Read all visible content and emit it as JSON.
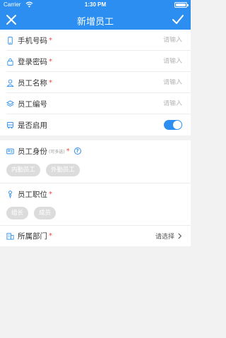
{
  "status_bar": {
    "carrier": "Carrier",
    "time": "1:30 PM"
  },
  "nav": {
    "title": "新增员工"
  },
  "form": {
    "phone": {
      "label": "手机号码",
      "required": "*",
      "placeholder": "请输入"
    },
    "password": {
      "label": "登录密码",
      "required": "*",
      "placeholder": "请输入"
    },
    "name": {
      "label": "员工名称",
      "required": "*",
      "placeholder": "请输入"
    },
    "number": {
      "label": "员工编号",
      "placeholder": "请输入"
    },
    "enabled": {
      "label": "是否启用",
      "on": true
    }
  },
  "identity": {
    "label": "员工身份",
    "hint": "(可多选)",
    "required": "*",
    "help": "?",
    "options": [
      "内勤员工",
      "外勤员工"
    ]
  },
  "position": {
    "label": "员工职位",
    "required": "*",
    "options": [
      "组长",
      "成员"
    ]
  },
  "department": {
    "label": "所属部门",
    "required": "*",
    "value": "请选择"
  },
  "colors": {
    "primary": "#2b8ef0",
    "required": "#e24a4a",
    "chip": "#dcdcdc"
  }
}
